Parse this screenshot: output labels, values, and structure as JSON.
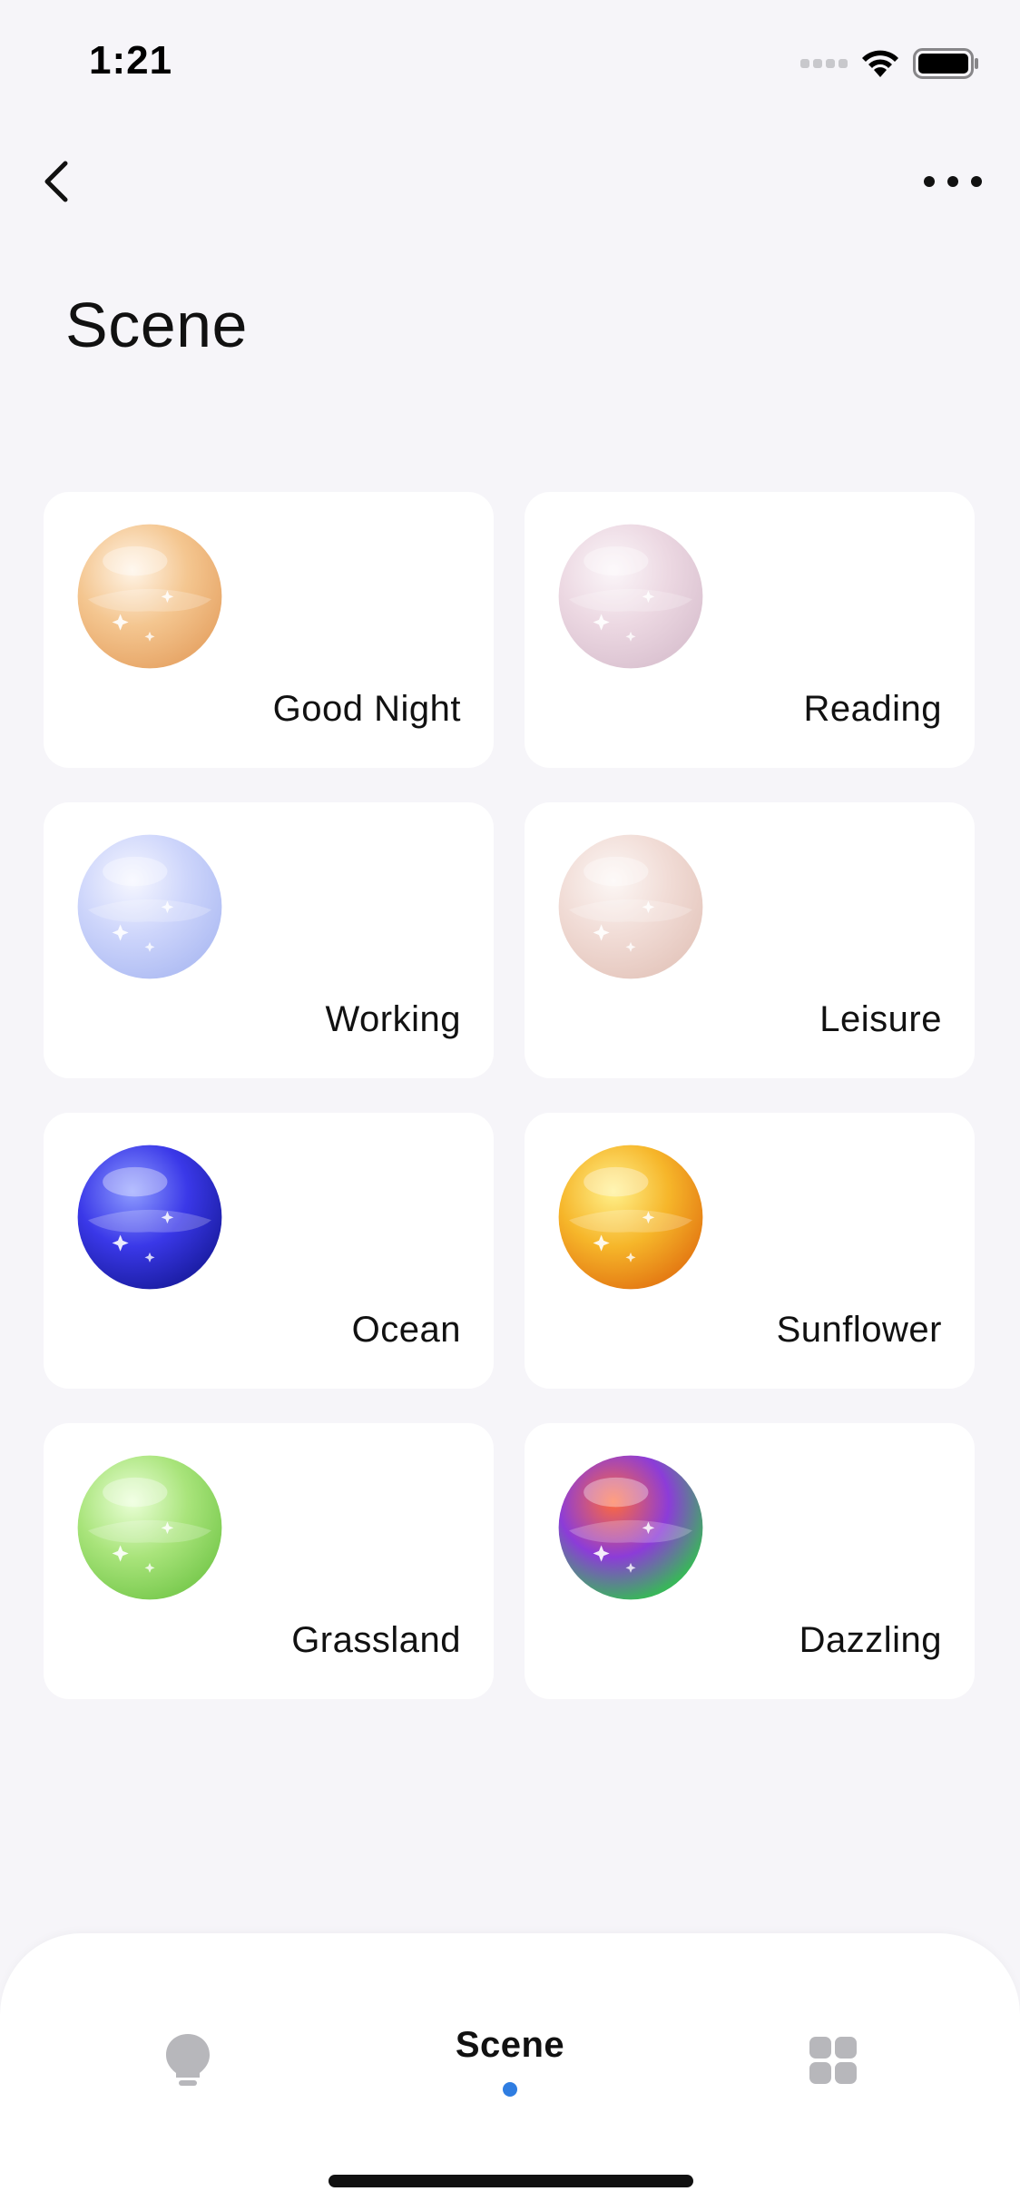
{
  "status_bar": {
    "time": "1:21",
    "icons": [
      "cellular-signal-icon",
      "wifi-icon",
      "battery-icon"
    ]
  },
  "nav": {
    "back_icon": "chevron-left-icon",
    "more_icon": "more-horizontal-icon"
  },
  "page": {
    "title": "Scene"
  },
  "scenes": [
    {
      "label": "Good Night",
      "orb_colors": [
        "#fff4e6",
        "#f4c690",
        "#e8a86a"
      ]
    },
    {
      "label": "Reading",
      "orb_colors": [
        "#fbf6f9",
        "#ecd8e2",
        "#dcc4d2"
      ]
    },
    {
      "label": "Working",
      "orb_colors": [
        "#f6f7ff",
        "#cdd5fb",
        "#b2bff4"
      ]
    },
    {
      "label": "Leisure",
      "orb_colors": [
        "#fcf7f5",
        "#f1dcd6",
        "#e6c9c0"
      ]
    },
    {
      "label": "Ocean",
      "orb_colors": [
        "#8e9cff",
        "#3a38e8",
        "#1d1fa8"
      ]
    },
    {
      "label": "Sunflower",
      "orb_colors": [
        "#fff08a",
        "#f6b62a",
        "#e57d14"
      ]
    },
    {
      "label": "Grassland",
      "orb_colors": [
        "#eaffd6",
        "#a9e47b",
        "#7dcc52"
      ]
    },
    {
      "label": "Dazzling",
      "orb_colors": [
        "#ff6a3c",
        "#8c3cd8",
        "#39b65a"
      ]
    }
  ],
  "tab_bar": {
    "tabs": [
      {
        "icon": "lightbulb-icon",
        "label": ""
      },
      {
        "icon": "",
        "label": "Scene",
        "active": true
      },
      {
        "icon": "grid-icon",
        "label": ""
      }
    ],
    "active_color": "#2f7de1"
  }
}
